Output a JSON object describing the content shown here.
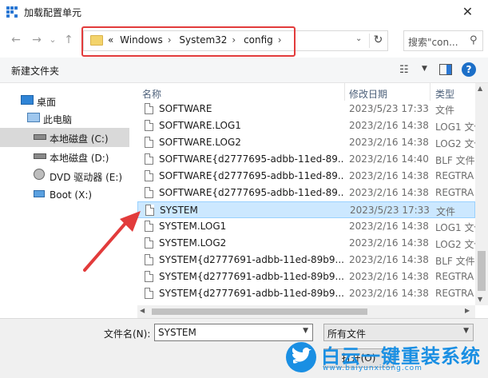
{
  "window": {
    "title": "加载配置单元"
  },
  "nav": {
    "back": "←",
    "forward": "→",
    "recent": "⌄",
    "up": "↑",
    "breadcrumbs": [
      "Windows",
      "System32",
      "config"
    ],
    "chevron_prefix": "«",
    "refresh": "↻",
    "search_placeholder": "搜索\"con..."
  },
  "toolbar": {
    "new_folder": "新建文件夹"
  },
  "sidebar": {
    "items": [
      {
        "label": "桌面",
        "icon": "desktop-icon"
      },
      {
        "label": "此电脑",
        "icon": "computer-icon"
      },
      {
        "label": "本地磁盘 (C:)",
        "icon": "drive-icon",
        "selected": true
      },
      {
        "label": "本地磁盘 (D:)",
        "icon": "drive-icon"
      },
      {
        "label": "DVD 驱动器 (E:)",
        "icon": "dvd-icon"
      },
      {
        "label": "Boot (X:)",
        "icon": "usb-icon"
      }
    ]
  },
  "columns": {
    "name": "名称",
    "date": "修改日期",
    "type": "类型"
  },
  "files": [
    {
      "name": "SOFTWARE",
      "date": "2023/5/23 17:33",
      "type": "文件"
    },
    {
      "name": "SOFTWARE.LOG1",
      "date": "2023/2/16 14:38",
      "type": "LOG1 文件"
    },
    {
      "name": "SOFTWARE.LOG2",
      "date": "2023/2/16 14:38",
      "type": "LOG2 文件"
    },
    {
      "name": "SOFTWARE{d2777695-adbb-11ed-89...",
      "date": "2023/2/16 14:40",
      "type": "BLF 文件"
    },
    {
      "name": "SOFTWARE{d2777695-adbb-11ed-89...",
      "date": "2023/2/16 14:38",
      "type": "REGTRA"
    },
    {
      "name": "SOFTWARE{d2777695-adbb-11ed-89...",
      "date": "2023/2/16 14:38",
      "type": "REGTRA"
    },
    {
      "name": "SYSTEM",
      "date": "2023/5/23 17:33",
      "type": "文件",
      "selected": true
    },
    {
      "name": "SYSTEM.LOG1",
      "date": "2023/2/16 14:38",
      "type": "LOG1 文件"
    },
    {
      "name": "SYSTEM.LOG2",
      "date": "2023/2/16 14:38",
      "type": "LOG2 文件"
    },
    {
      "name": "SYSTEM{d2777691-adbb-11ed-89b9...",
      "date": "2023/2/16 14:38",
      "type": "BLF 文件"
    },
    {
      "name": "SYSTEM{d2777691-adbb-11ed-89b9...",
      "date": "2023/2/16 14:38",
      "type": "REGTRA"
    },
    {
      "name": "SYSTEM{d2777691-adbb-11ed-89b9...",
      "date": "2023/2/16 14:38",
      "type": "REGTRA"
    }
  ],
  "footer": {
    "filename_label": "文件名(N):",
    "filename_value": "SYSTEM",
    "filter_value": "所有文件",
    "open_label": "打开(O)"
  },
  "watermark": {
    "brand": "白云一键重装系统",
    "url": "www.baiyunxitong.com"
  },
  "colors": {
    "accent": "#1c6fc8",
    "highlight": "#e23b3b",
    "selection": "#cce8ff"
  }
}
